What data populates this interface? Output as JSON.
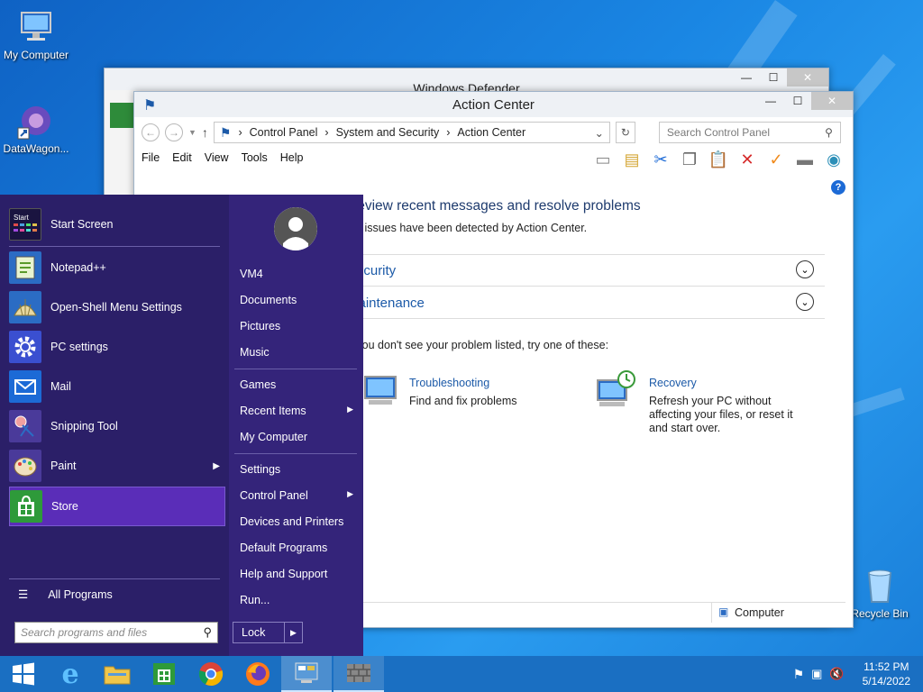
{
  "desktop": {
    "icons": [
      {
        "label": "My Computer"
      },
      {
        "label": "DataWagon..."
      },
      {
        "label": "Recycle Bin"
      }
    ]
  },
  "defender_window": {
    "title": "Windows Defender"
  },
  "action_center": {
    "title": "Action Center",
    "breadcrumb": [
      "Control Panel",
      "System and Security",
      "Action Center"
    ],
    "search_placeholder": "Search Control Panel",
    "menu": [
      "File",
      "Edit",
      "View",
      "Tools",
      "Help"
    ],
    "heading": "Review recent messages and resolve problems",
    "subheading": "No issues have been detected by Action Center.",
    "sections": [
      {
        "label": "Security"
      },
      {
        "label": "Maintenance"
      }
    ],
    "hint": "If you don't see your problem listed, try one of these:",
    "options": [
      {
        "title": "Troubleshooting",
        "desc": "Find and fix problems"
      },
      {
        "title": "Recovery",
        "desc": "Refresh your PC without affecting your files, or reset it and start over."
      }
    ],
    "status_bar": "Computer"
  },
  "start_menu": {
    "left_items": [
      {
        "label": "Start Screen",
        "icon": "start-screen-icon"
      },
      {
        "label": "Notepad++",
        "icon": "notepadpp-icon"
      },
      {
        "label": "Open-Shell Menu Settings",
        "icon": "open-shell-icon"
      },
      {
        "label": "PC settings",
        "icon": "gear-icon"
      },
      {
        "label": "Mail",
        "icon": "mail-icon"
      },
      {
        "label": "Snipping Tool",
        "icon": "scissors-icon"
      },
      {
        "label": "Paint",
        "icon": "paint-palette-icon"
      },
      {
        "label": "Store",
        "icon": "store-icon"
      }
    ],
    "all_programs": "All Programs",
    "search_placeholder": "Search programs and files",
    "right_items": [
      {
        "label": "VM4"
      },
      {
        "label": "Documents"
      },
      {
        "label": "Pictures"
      },
      {
        "label": "Music"
      },
      {
        "label": "Games"
      },
      {
        "label": "Recent Items"
      },
      {
        "label": "My Computer"
      },
      {
        "label": "Settings"
      },
      {
        "label": "Control Panel"
      },
      {
        "label": "Devices and Printers"
      },
      {
        "label": "Default Programs"
      },
      {
        "label": "Help and Support"
      },
      {
        "label": "Run..."
      }
    ],
    "lock_label": "Lock"
  },
  "taskbar": {
    "time": "11:52 PM",
    "date": "5/14/2022"
  },
  "colors": {
    "start_menu_bg": "#34247a",
    "start_menu_left": "#2b1f68",
    "selected_item": "#5a2db8",
    "taskbar": "#1a6fc2",
    "link": "#1c5aa8"
  }
}
